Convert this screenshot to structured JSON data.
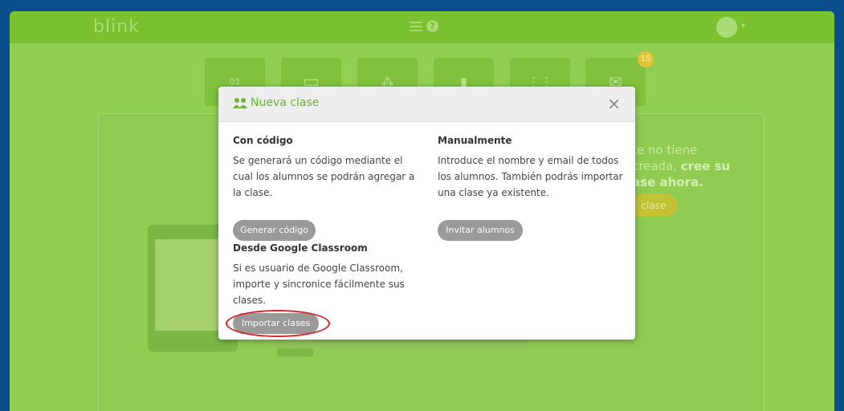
{
  "app": {
    "brand": "blink"
  },
  "header": {
    "help_icon": "?",
    "user_caret": "▾"
  },
  "toolbar": {
    "tiles": [
      {
        "icon": "calendar-icon",
        "glyph": "01"
      },
      {
        "icon": "screen-icon",
        "glyph": "▭"
      },
      {
        "icon": "group-icon",
        "glyph": "⁂"
      },
      {
        "icon": "chart-icon",
        "glyph": "▮"
      },
      {
        "icon": "people-icon",
        "glyph": "⋮⋮"
      },
      {
        "icon": "mail-icon",
        "glyph": "✉"
      }
    ],
    "mail_badge": "15"
  },
  "background": {
    "text_normal_1": "te no tiene",
    "text_normal_2": "creada, ",
    "text_bold_2": "cree su",
    "text_bold_3": "ase ahora.",
    "button": "clase"
  },
  "modal": {
    "title": "Nueva clase",
    "close": "×",
    "code": {
      "title": "Con código",
      "desc": "Se generará un código mediante el cual los alumnos se podrán agregar a la clase.",
      "button": "Generar código"
    },
    "manual": {
      "title": "Manualmente",
      "desc": "Introduce el nombre y email de todos los alumnos. También podrás importar una clase ya existente.",
      "button": "Invitar alumnos"
    },
    "google": {
      "title": "Desde Google Classroom",
      "desc": "Si es usuario de Google Classroom, importe y sincronice fácilmente sus clases.",
      "button": "Importar clases"
    }
  },
  "colors": {
    "frame": "#0a4f8c",
    "overlay_green": "#91cf53",
    "accent_green": "#6ab42e",
    "button_gray": "#9a9a9a",
    "highlight_red": "#d8232a"
  }
}
